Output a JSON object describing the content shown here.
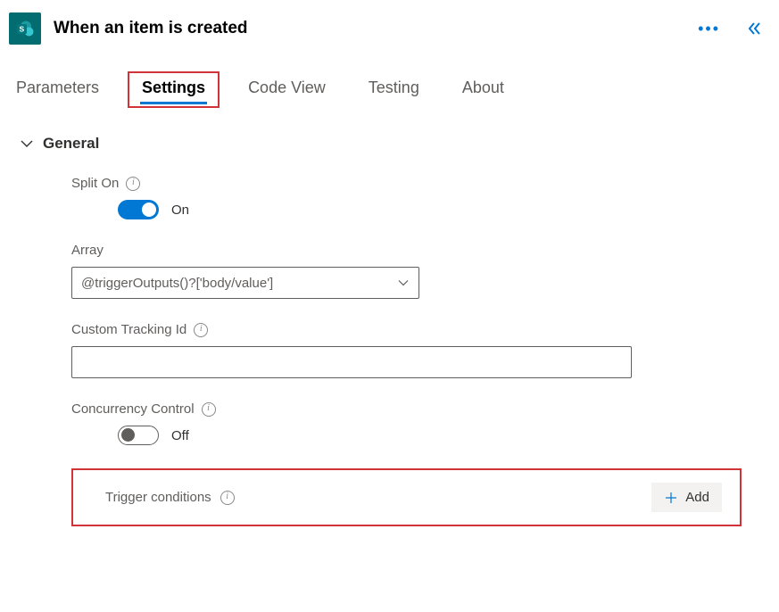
{
  "header": {
    "title": "When an item is created",
    "icon_name": "sharepoint-icon"
  },
  "tabs": {
    "items": [
      {
        "label": "Parameters",
        "active": false
      },
      {
        "label": "Settings",
        "active": true
      },
      {
        "label": "Code View",
        "active": false
      },
      {
        "label": "Testing",
        "active": false
      },
      {
        "label": "About",
        "active": false
      }
    ]
  },
  "section": {
    "title": "General",
    "split_on": {
      "label": "Split On",
      "state_label": "On",
      "state": true
    },
    "array": {
      "label": "Array",
      "value": "@triggerOutputs()?['body/value']"
    },
    "custom_tracking": {
      "label": "Custom Tracking Id",
      "value": ""
    },
    "concurrency": {
      "label": "Concurrency Control",
      "state_label": "Off",
      "state": false
    },
    "trigger_conditions": {
      "label": "Trigger conditions",
      "add_label": "Add"
    }
  }
}
